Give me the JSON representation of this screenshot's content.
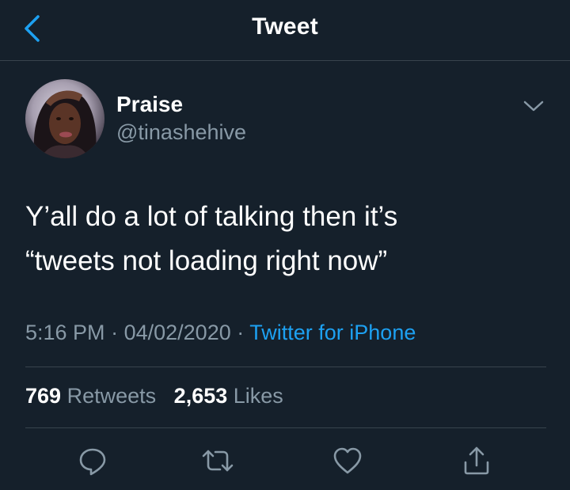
{
  "navbar": {
    "title": "Tweet",
    "back_icon": "chevron-left-icon"
  },
  "author": {
    "display_name": "Praise",
    "handle": "@tinashehive",
    "caret_icon": "chevron-down-icon"
  },
  "tweet": {
    "lines": [
      "Y’all do a lot of talking then it’s",
      "“tweets not loading right now”"
    ],
    "time": "5:16 PM",
    "date": "04/02/2020",
    "separator": "·",
    "source": "Twitter for iPhone"
  },
  "stats": {
    "retweets_count": "769",
    "retweets_label": "Retweets",
    "likes_count": "2,653",
    "likes_label": "Likes"
  },
  "actions": {
    "reply_icon": "reply-icon",
    "retweet_icon": "retweet-icon",
    "like_icon": "heart-icon",
    "share_icon": "share-icon"
  },
  "colors": {
    "background": "#15202b",
    "accent": "#1da1f2",
    "secondary_text": "#8899a6",
    "divider": "#38444d"
  }
}
